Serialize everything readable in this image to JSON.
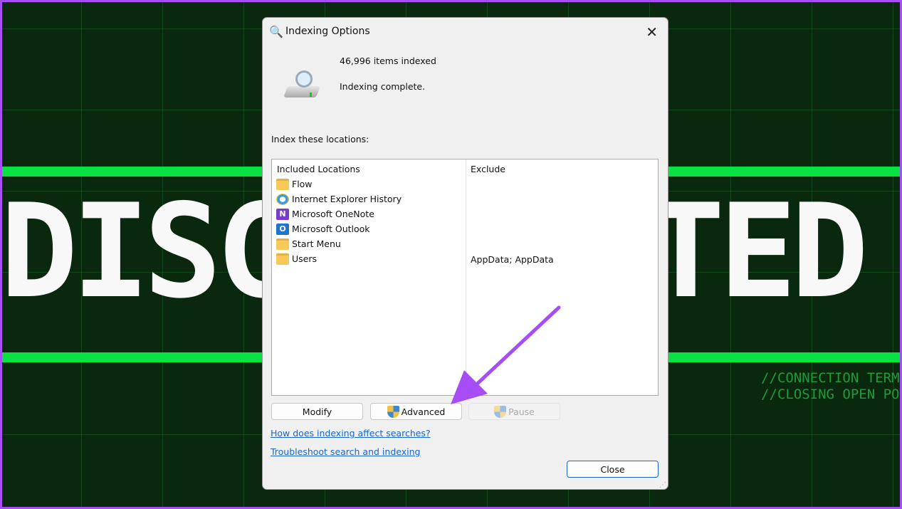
{
  "background": {
    "big_text": "DISCONNECTED",
    "terminal_lines": [
      "//CONNECTION TERMI",
      "//CLOSING OPEN POR"
    ],
    "accent": "#08e243",
    "border_color": "#a64df5"
  },
  "dialog": {
    "title": "Indexing Options",
    "items_indexed": "46,996 items indexed",
    "status": "Indexing complete.",
    "locations_label": "Index these locations:",
    "columns": [
      "Included Locations",
      "Exclude"
    ],
    "rows": [
      {
        "name": "Flow",
        "icon": "folder-icon",
        "exclude": ""
      },
      {
        "name": "Internet Explorer History",
        "icon": "internet-explorer-icon",
        "exclude": ""
      },
      {
        "name": "Microsoft OneNote",
        "icon": "onenote-icon",
        "exclude": ""
      },
      {
        "name": "Microsoft Outlook",
        "icon": "outlook-icon",
        "exclude": ""
      },
      {
        "name": "Start Menu",
        "icon": "folder-icon",
        "exclude": ""
      },
      {
        "name": "Users",
        "icon": "folder-icon",
        "exclude": "AppData; AppData"
      }
    ],
    "buttons": {
      "modify": "Modify",
      "advanced": "Advanced",
      "pause": "Pause",
      "close": "Close"
    },
    "links": [
      "How does indexing affect searches?",
      "Troubleshoot search and indexing"
    ]
  },
  "annotation": {
    "arrow_color": "#a64df5",
    "points_to": "Advanced"
  }
}
